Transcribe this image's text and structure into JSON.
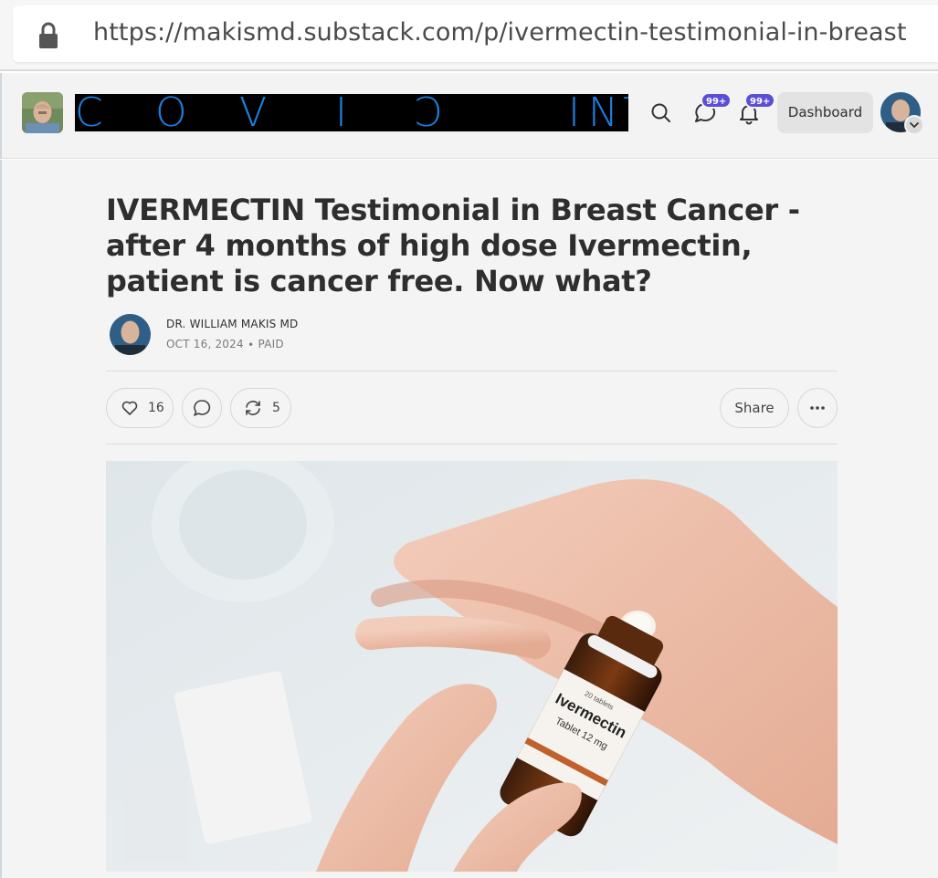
{
  "browser": {
    "url": "https://makismd.substack.com/p/ivermectin-testimonial-in-breast"
  },
  "header": {
    "logo_text": "COVID INT",
    "logo_color": "#1d7fe0",
    "chat_badge": "99+",
    "notifications_badge": "99+",
    "dashboard_label": "Dashboard",
    "badge_color": "#5b4fd6"
  },
  "post": {
    "title": "IVERMECTIN Testimonial in Breast Cancer - after 4 months of high dose Ivermectin, patient is cancer free. Now what?",
    "author": "DR. WILLIAM MAKIS MD",
    "meta": "OCT 16, 2024 ∙ PAID",
    "likes": "16",
    "restacks": "5",
    "share_label": "Share"
  },
  "hero_image": {
    "bottle_label_title": "Ivermectin",
    "bottle_label_sub": "Tablet 12 mg",
    "bottle_label_tag": "20 tablets"
  }
}
